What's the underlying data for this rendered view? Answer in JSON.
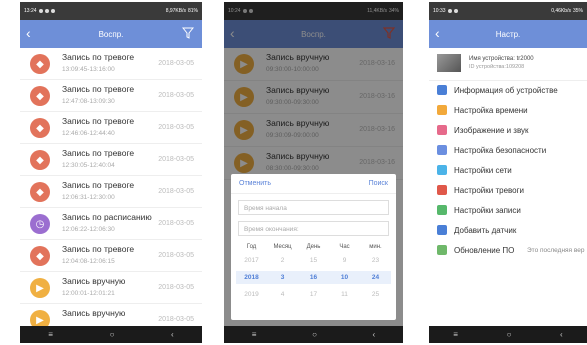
{
  "phone1": {
    "status_time": "13:24",
    "status_right": "8,97KB/s",
    "battery": "81%",
    "header_title": "Воспр.",
    "rows": [
      {
        "type": "alarm",
        "title": "Запись по тревоге",
        "time": "13:09:45-13:16:00",
        "date": "2018-03-05"
      },
      {
        "type": "alarm",
        "title": "Запись по тревоге",
        "time": "12:47:08-13:09:30",
        "date": "2018-03-05"
      },
      {
        "type": "alarm",
        "title": "Запись по тревоге",
        "time": "12:46:06-12:44:40",
        "date": "2018-03-05"
      },
      {
        "type": "alarm",
        "title": "Запись по тревоге",
        "time": "12:30:05-12:40:04",
        "date": "2018-03-05"
      },
      {
        "type": "alarm",
        "title": "Запись по тревоге",
        "time": "12:06:31-12:30:00",
        "date": "2018-03-05"
      },
      {
        "type": "sched",
        "title": "Запись по расписанию",
        "time": "12:06:22-12:06:30",
        "date": "2018-03-05"
      },
      {
        "type": "alarm",
        "title": "Запись по тревоге",
        "time": "12:04:08-12:06:15",
        "date": "2018-03-05"
      },
      {
        "type": "manual",
        "title": "Запись вручную",
        "time": "12:00:01-12:01:21",
        "date": "2018-03-05"
      },
      {
        "type": "manual",
        "title": "Запись вручную",
        "time": "",
        "date": "2018-03-05"
      }
    ]
  },
  "phone2": {
    "status_time": "10:24",
    "status_right": "11,4KB/s",
    "battery": "34%",
    "header_title": "Воспр.",
    "rows": [
      {
        "title": "Запись вручную",
        "time": "09:30:00-10:00:00",
        "date": "2018-03-16"
      },
      {
        "title": "Запись вручную",
        "time": "09:30:00-09:30:00",
        "date": "2018-03-16"
      },
      {
        "title": "Запись вручную",
        "time": "09:30:09-09:00:00",
        "date": "2018-03-16"
      },
      {
        "title": "Запись вручную",
        "time": "08:30:00-09:30:00",
        "date": "2018-03-16"
      }
    ],
    "dialog": {
      "cancel": "Отменить",
      "search": "Поиск",
      "start_placeholder": "Время начала",
      "end_placeholder": "Время окончания:",
      "columns": [
        "Год",
        "Месяц",
        "День",
        "Час",
        "мин."
      ],
      "picker_rows": [
        [
          "2017",
          "2",
          "15",
          "9",
          "23"
        ],
        [
          "2018",
          "3",
          "16",
          "10",
          "24"
        ],
        [
          "2019",
          "4",
          "17",
          "11",
          "25"
        ]
      ]
    }
  },
  "phone3": {
    "status_time": "10:33",
    "status_right": "0,46Kb/s",
    "battery": "35%",
    "header_title": "Настр.",
    "device_name": "Имя устройства: tr2000",
    "device_id": "ID устройства:109208",
    "menu": [
      {
        "label": "Информация об устройстве",
        "color": "#4a7fd6"
      },
      {
        "label": "Настройка времени",
        "color": "#f2a93b"
      },
      {
        "label": "Изображение и звук",
        "color": "#e66a8b"
      },
      {
        "label": "Настройка безопасности",
        "color": "#6b8fe0"
      },
      {
        "label": "Настройки сети",
        "color": "#4bb3e8"
      },
      {
        "label": "Настройки тревоги",
        "color": "#e0584a"
      },
      {
        "label": "Настройки записи",
        "color": "#56b86b"
      },
      {
        "label": "Добавить датчик",
        "color": "#4a7fd6"
      },
      {
        "label": "Обновление ПО",
        "color": "#6fb86a",
        "note": "Это последняя вер"
      }
    ]
  }
}
